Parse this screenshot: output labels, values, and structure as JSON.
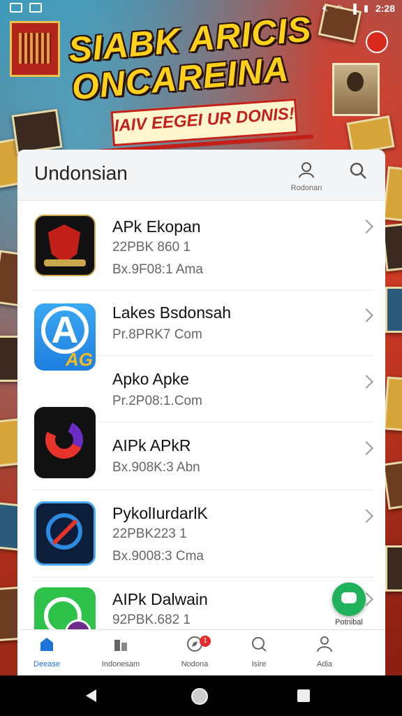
{
  "status": {
    "time": "2:28"
  },
  "hero": {
    "title_line1": "SIABK ARICIS",
    "title_line2": "ONCAREINA",
    "banner": "IAIV EEGEI UR DONIS!"
  },
  "header": {
    "title": "Undonsian",
    "profile_label": "Rodonan"
  },
  "apps": [
    {
      "name": "APk Ekopan",
      "line2": "22PBK 860 1",
      "line3": "Bx.9F08:1 Ama",
      "icon": "red-emblem-icon"
    },
    {
      "name": "Lakes Bsdonsah",
      "line2": "Pr.8PRK7 Com",
      "line3": "",
      "icon": "app-store-a-icon"
    },
    {
      "name": "Apko Apke",
      "line2": "Pr.2P08:1.Com",
      "line3": "",
      "icon": "swirl-logo-icon"
    },
    {
      "name": "AIPk APkR",
      "line2": "Bx.908K:3 Abn",
      "line3": "",
      "icon": "blue-circle-icon"
    },
    {
      "name": "PykolIurdarlK",
      "line2": "22PBK223 1",
      "line3": "Bx.9008:3 Cma",
      "icon": "blue-circle-icon"
    },
    {
      "name": "AIPk Dalwain",
      "line2": "92PBK.682 1",
      "line3": "",
      "icon": "green-chat-icon"
    }
  ],
  "fab": {
    "label": "Potnibal"
  },
  "tabs": [
    {
      "label": "Deease",
      "icon": "home-icon"
    },
    {
      "label": "Indonesam",
      "icon": "grid-icon"
    },
    {
      "label": "Nodona",
      "icon": "compass-icon",
      "badge": "1"
    },
    {
      "label": "Isire",
      "icon": "search-icon"
    },
    {
      "label": "Adia",
      "icon": "person-icon"
    }
  ]
}
